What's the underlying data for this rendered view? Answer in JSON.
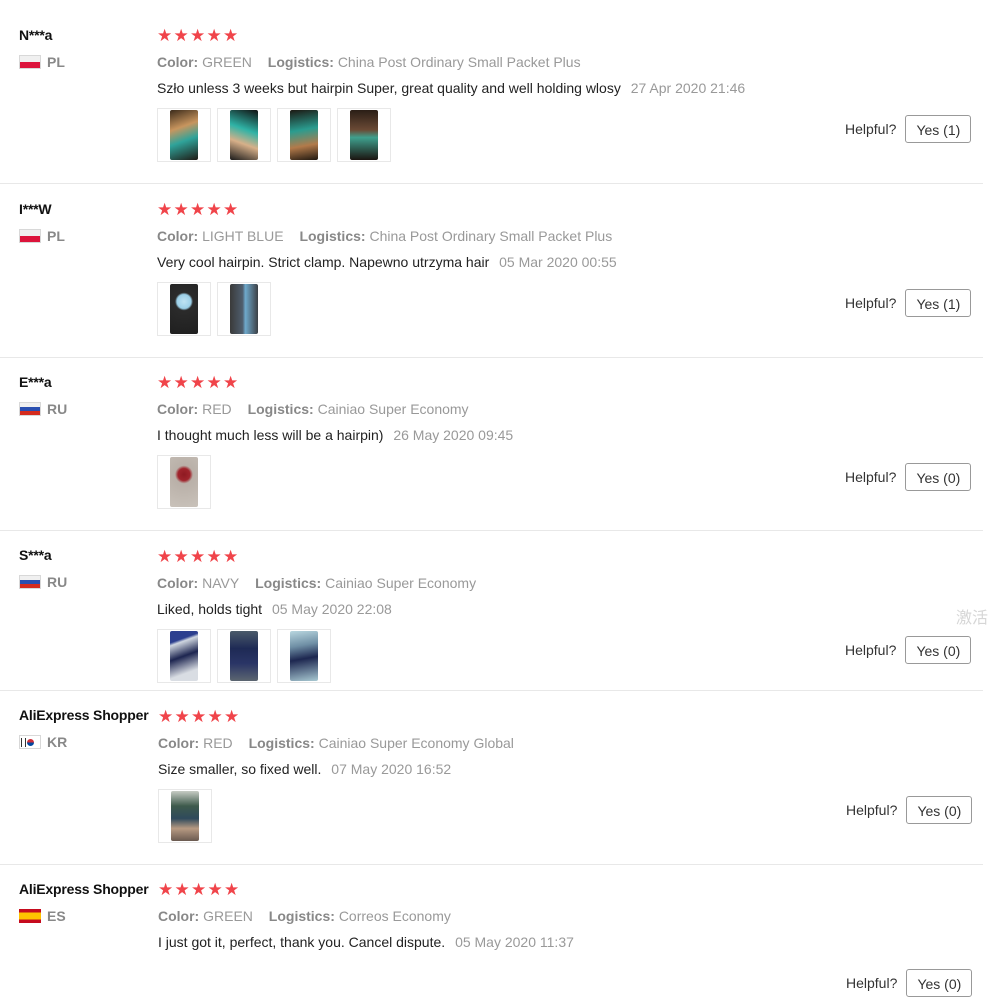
{
  "labels": {
    "color": "Color:",
    "logistics": "Logistics:",
    "helpful": "Helpful?"
  },
  "colors": {
    "star": "#f0444a",
    "accent_text": "#999999"
  },
  "reviews": [
    {
      "user": "N***a",
      "country": "PL",
      "flag": "pl-flag-icon",
      "rating": 5,
      "color": "GREEN",
      "logistics": "China Post Ordinary Small Packet Plus",
      "text": "Szło unless 3 weeks but hairpin Super, great quality and well holding wlosy",
      "date": "27 Apr 2020 21:46",
      "helpful": "Yes (1)",
      "photos": [
        "photo-hairpin-green-hand",
        "photo-hairpin-green-hand",
        "photo-hairpin-green-hand",
        "photo-hairpin-green-hair"
      ]
    },
    {
      "user": "I***W",
      "country": "PL",
      "flag": "pl-flag-icon",
      "rating": 5,
      "color": "LIGHT BLUE",
      "logistics": "China Post Ordinary Small Packet Plus",
      "text": "Very cool hairpin. Strict clamp. Napewno utrzyma hair",
      "date": "05 Mar 2020 00:55",
      "helpful": "Yes (1)",
      "photos": [
        "photo-hairpin-lightblue",
        "photo-hairpin-lightblue"
      ]
    },
    {
      "user": "E***a",
      "country": "RU",
      "flag": "ru-flag-icon",
      "rating": 5,
      "color": "RED",
      "logistics": "Cainiao Super Economy",
      "text": "I thought much less will be a hairpin)",
      "date": "26 May 2020 09:45",
      "helpful": "Yes (0)",
      "photos": [
        "photo-hairpin-red"
      ]
    },
    {
      "user": "S***a",
      "country": "RU",
      "flag": "ru-flag-icon",
      "rating": 5,
      "color": "NAVY",
      "logistics": "Cainiao Super Economy",
      "text": "Liked, holds tight",
      "date": "05 May 2020 22:08",
      "helpful": "Yes (0)",
      "photos": [
        "photo-hairpin-navy",
        "photo-hairpin-navy",
        "photo-hairpin-navy"
      ]
    },
    {
      "user": "AliExpress Shopper",
      "country": "KR",
      "flag": "kr-flag-icon",
      "rating": 5,
      "color": "RED",
      "logistics": "Cainiao Super Economy Global",
      "text": "Size smaller, so fixed well.",
      "date": "07 May 2020 16:52",
      "helpful": "Yes (0)",
      "photos": [
        "photo-hairpin-worn"
      ]
    },
    {
      "user": "AliExpress Shopper",
      "country": "ES",
      "flag": "es-flag-icon",
      "rating": 5,
      "color": "GREEN",
      "logistics": "Correos Economy",
      "text": "I just got it, perfect, thank you. Cancel dispute.",
      "date": "05 May 2020 11:37",
      "helpful": "Yes (0)",
      "photos": []
    }
  ],
  "watermark": "激活"
}
